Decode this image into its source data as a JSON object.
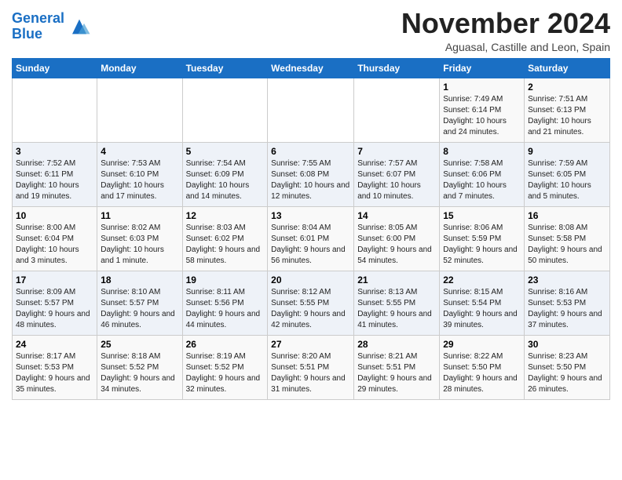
{
  "header": {
    "logo_line1": "General",
    "logo_line2": "Blue",
    "title": "November 2024",
    "subtitle": "Aguasal, Castille and Leon, Spain"
  },
  "weekdays": [
    "Sunday",
    "Monday",
    "Tuesday",
    "Wednesday",
    "Thursday",
    "Friday",
    "Saturday"
  ],
  "weeks": [
    [
      {
        "day": "",
        "info": ""
      },
      {
        "day": "",
        "info": ""
      },
      {
        "day": "",
        "info": ""
      },
      {
        "day": "",
        "info": ""
      },
      {
        "day": "",
        "info": ""
      },
      {
        "day": "1",
        "info": "Sunrise: 7:49 AM\nSunset: 6:14 PM\nDaylight: 10 hours and 24 minutes."
      },
      {
        "day": "2",
        "info": "Sunrise: 7:51 AM\nSunset: 6:13 PM\nDaylight: 10 hours and 21 minutes."
      }
    ],
    [
      {
        "day": "3",
        "info": "Sunrise: 7:52 AM\nSunset: 6:11 PM\nDaylight: 10 hours and 19 minutes."
      },
      {
        "day": "4",
        "info": "Sunrise: 7:53 AM\nSunset: 6:10 PM\nDaylight: 10 hours and 17 minutes."
      },
      {
        "day": "5",
        "info": "Sunrise: 7:54 AM\nSunset: 6:09 PM\nDaylight: 10 hours and 14 minutes."
      },
      {
        "day": "6",
        "info": "Sunrise: 7:55 AM\nSunset: 6:08 PM\nDaylight: 10 hours and 12 minutes."
      },
      {
        "day": "7",
        "info": "Sunrise: 7:57 AM\nSunset: 6:07 PM\nDaylight: 10 hours and 10 minutes."
      },
      {
        "day": "8",
        "info": "Sunrise: 7:58 AM\nSunset: 6:06 PM\nDaylight: 10 hours and 7 minutes."
      },
      {
        "day": "9",
        "info": "Sunrise: 7:59 AM\nSunset: 6:05 PM\nDaylight: 10 hours and 5 minutes."
      }
    ],
    [
      {
        "day": "10",
        "info": "Sunrise: 8:00 AM\nSunset: 6:04 PM\nDaylight: 10 hours and 3 minutes."
      },
      {
        "day": "11",
        "info": "Sunrise: 8:02 AM\nSunset: 6:03 PM\nDaylight: 10 hours and 1 minute."
      },
      {
        "day": "12",
        "info": "Sunrise: 8:03 AM\nSunset: 6:02 PM\nDaylight: 9 hours and 58 minutes."
      },
      {
        "day": "13",
        "info": "Sunrise: 8:04 AM\nSunset: 6:01 PM\nDaylight: 9 hours and 56 minutes."
      },
      {
        "day": "14",
        "info": "Sunrise: 8:05 AM\nSunset: 6:00 PM\nDaylight: 9 hours and 54 minutes."
      },
      {
        "day": "15",
        "info": "Sunrise: 8:06 AM\nSunset: 5:59 PM\nDaylight: 9 hours and 52 minutes."
      },
      {
        "day": "16",
        "info": "Sunrise: 8:08 AM\nSunset: 5:58 PM\nDaylight: 9 hours and 50 minutes."
      }
    ],
    [
      {
        "day": "17",
        "info": "Sunrise: 8:09 AM\nSunset: 5:57 PM\nDaylight: 9 hours and 48 minutes."
      },
      {
        "day": "18",
        "info": "Sunrise: 8:10 AM\nSunset: 5:57 PM\nDaylight: 9 hours and 46 minutes."
      },
      {
        "day": "19",
        "info": "Sunrise: 8:11 AM\nSunset: 5:56 PM\nDaylight: 9 hours and 44 minutes."
      },
      {
        "day": "20",
        "info": "Sunrise: 8:12 AM\nSunset: 5:55 PM\nDaylight: 9 hours and 42 minutes."
      },
      {
        "day": "21",
        "info": "Sunrise: 8:13 AM\nSunset: 5:55 PM\nDaylight: 9 hours and 41 minutes."
      },
      {
        "day": "22",
        "info": "Sunrise: 8:15 AM\nSunset: 5:54 PM\nDaylight: 9 hours and 39 minutes."
      },
      {
        "day": "23",
        "info": "Sunrise: 8:16 AM\nSunset: 5:53 PM\nDaylight: 9 hours and 37 minutes."
      }
    ],
    [
      {
        "day": "24",
        "info": "Sunrise: 8:17 AM\nSunset: 5:53 PM\nDaylight: 9 hours and 35 minutes."
      },
      {
        "day": "25",
        "info": "Sunrise: 8:18 AM\nSunset: 5:52 PM\nDaylight: 9 hours and 34 minutes."
      },
      {
        "day": "26",
        "info": "Sunrise: 8:19 AM\nSunset: 5:52 PM\nDaylight: 9 hours and 32 minutes."
      },
      {
        "day": "27",
        "info": "Sunrise: 8:20 AM\nSunset: 5:51 PM\nDaylight: 9 hours and 31 minutes."
      },
      {
        "day": "28",
        "info": "Sunrise: 8:21 AM\nSunset: 5:51 PM\nDaylight: 9 hours and 29 minutes."
      },
      {
        "day": "29",
        "info": "Sunrise: 8:22 AM\nSunset: 5:50 PM\nDaylight: 9 hours and 28 minutes."
      },
      {
        "day": "30",
        "info": "Sunrise: 8:23 AM\nSunset: 5:50 PM\nDaylight: 9 hours and 26 minutes."
      }
    ]
  ]
}
